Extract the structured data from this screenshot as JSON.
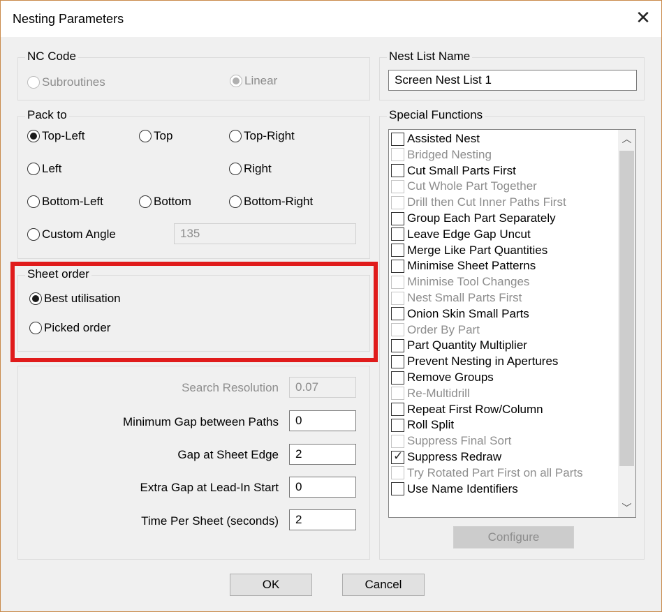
{
  "dialog": {
    "title": "Nesting Parameters"
  },
  "nc_code": {
    "label": "NC Code",
    "options": [
      {
        "label": "Subroutines",
        "selected": false
      },
      {
        "label": "Linear",
        "selected": true
      }
    ]
  },
  "nest_list": {
    "label": "Nest List Name",
    "value": "Screen Nest List 1"
  },
  "pack_to": {
    "label": "Pack to",
    "options": [
      "Top-Left",
      "Top",
      "Top-Right",
      "Left",
      "Right",
      "Bottom-Left",
      "Bottom",
      "Bottom-Right",
      "Custom Angle"
    ],
    "selected": "Top-Left",
    "custom_angle_value": "135"
  },
  "sheet_order": {
    "label": "Sheet order",
    "options": [
      "Best utilisation",
      "Picked order"
    ],
    "selected": "Best utilisation"
  },
  "params": [
    {
      "label": "Search Resolution",
      "value": "0.07",
      "enabled": false
    },
    {
      "label": "Minimum Gap between Paths",
      "value": "0",
      "enabled": true
    },
    {
      "label": "Gap at Sheet Edge",
      "value": "2",
      "enabled": true
    },
    {
      "label": "Extra Gap at Lead-In Start",
      "value": "0",
      "enabled": true
    },
    {
      "label": "Time Per Sheet (seconds)",
      "value": "2",
      "enabled": true
    }
  ],
  "special_functions": {
    "label": "Special Functions",
    "items": [
      {
        "label": "Assisted Nest",
        "enabled": true,
        "checked": false
      },
      {
        "label": "Bridged Nesting",
        "enabled": false,
        "checked": false
      },
      {
        "label": "Cut Small Parts First",
        "enabled": true,
        "checked": false
      },
      {
        "label": "Cut Whole Part Together",
        "enabled": false,
        "checked": false
      },
      {
        "label": "Drill then Cut Inner Paths First",
        "enabled": false,
        "checked": false
      },
      {
        "label": "Group Each Part Separately",
        "enabled": true,
        "checked": false
      },
      {
        "label": "Leave Edge Gap Uncut",
        "enabled": true,
        "checked": false
      },
      {
        "label": "Merge Like Part Quantities",
        "enabled": true,
        "checked": false
      },
      {
        "label": "Minimise Sheet Patterns",
        "enabled": true,
        "checked": false
      },
      {
        "label": "Minimise Tool Changes",
        "enabled": false,
        "checked": false
      },
      {
        "label": "Nest Small Parts First",
        "enabled": false,
        "checked": false
      },
      {
        "label": "Onion Skin Small Parts",
        "enabled": true,
        "checked": false
      },
      {
        "label": "Order By Part",
        "enabled": false,
        "checked": false
      },
      {
        "label": "Part Quantity Multiplier",
        "enabled": true,
        "checked": false
      },
      {
        "label": "Prevent Nesting in Apertures",
        "enabled": true,
        "checked": false
      },
      {
        "label": "Remove Groups",
        "enabled": true,
        "checked": false
      },
      {
        "label": "Re-Multidrill",
        "enabled": false,
        "checked": false
      },
      {
        "label": "Repeat First Row/Column",
        "enabled": true,
        "checked": false
      },
      {
        "label": "Roll Split",
        "enabled": true,
        "checked": false
      },
      {
        "label": "Suppress Final Sort",
        "enabled": false,
        "checked": false
      },
      {
        "label": "Suppress Redraw",
        "enabled": true,
        "checked": true
      },
      {
        "label": "Try Rotated Part First on all Parts",
        "enabled": false,
        "checked": false
      },
      {
        "label": "Use Name Identifiers",
        "enabled": true,
        "checked": false
      }
    ],
    "configure_label": "Configure"
  },
  "buttons": {
    "ok": "OK",
    "cancel": "Cancel"
  },
  "colors": {
    "highlight": "#e01b1b",
    "dialog_bg": "#f0f0f0"
  }
}
